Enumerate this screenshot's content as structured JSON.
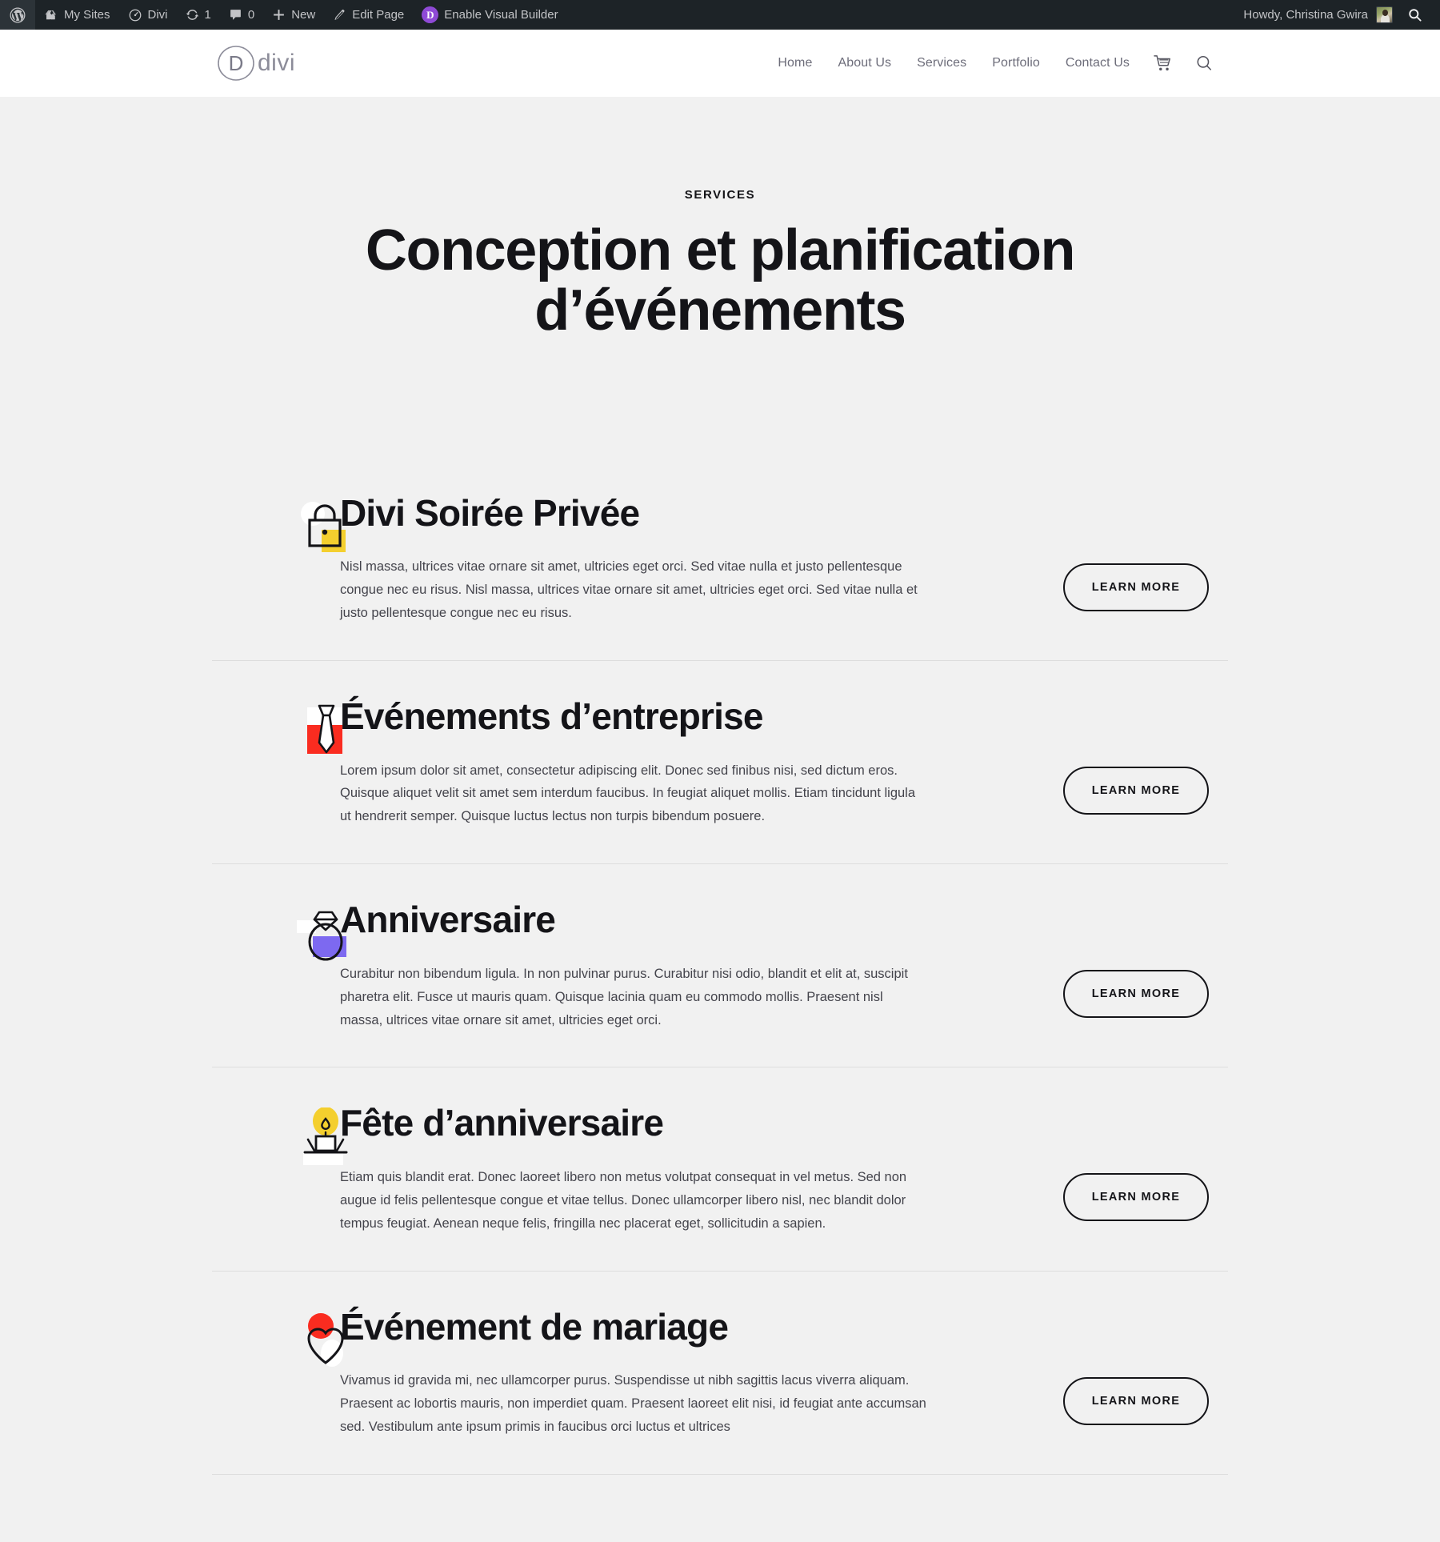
{
  "adminbar": {
    "left_items": [
      {
        "icon": "wordpress-logo-icon",
        "label": ""
      },
      {
        "icon": "my-sites-icon",
        "label": "My Sites"
      },
      {
        "icon": "divi-site-icon",
        "label": "Divi"
      },
      {
        "icon": "updates-icon",
        "label": "1"
      },
      {
        "icon": "comments-icon",
        "label": "0"
      },
      {
        "icon": "plus-icon",
        "label": "New"
      },
      {
        "icon": "pencil-icon",
        "label": "Edit Page"
      },
      {
        "icon": "divi-badge-icon",
        "label": "Enable Visual Builder"
      }
    ],
    "howdy": "Howdy, Christina Gwira",
    "search_icon": "search-icon"
  },
  "header": {
    "logo_letter": "D",
    "logo_word": "divi",
    "nav": [
      {
        "label": "Home"
      },
      {
        "label": "About Us"
      },
      {
        "label": "Services"
      },
      {
        "label": "Portfolio"
      },
      {
        "label": "Contact Us"
      }
    ],
    "cart_icon": "shopping-cart-icon",
    "search_icon": "search-icon"
  },
  "hero": {
    "eyebrow": "SERVICES",
    "title": "Conception et planification d’événements"
  },
  "colors": {
    "page_bg": "#f1f1f1",
    "text": "#141418",
    "accent_yellow": "#f4cf2e",
    "accent_red": "#fa2c20",
    "accent_purple": "#7d69f0",
    "adminbar_bg": "#1d2327",
    "divi_purple": "#8f4ad6"
  },
  "services": [
    {
      "icon": "lock-icon",
      "title": "Divi Soirée Privée",
      "text": "Nisl massa, ultrices vitae ornare sit amet, ultricies eget orci. Sed vitae nulla et justo pellentesque congue nec eu risus. Nisl massa, ultrices vitae ornare sit amet, ultricies eget orci. Sed vitae nulla et justo pellentesque congue nec eu risus.",
      "button": "LEARN MORE"
    },
    {
      "icon": "necktie-icon",
      "title": "Événements d’entreprise",
      "text": "Lorem ipsum dolor sit amet, consectetur adipiscing elit. Donec sed finibus nisi, sed dictum eros. Quisque aliquet velit sit amet sem interdum faucibus. In feugiat aliquet mollis. Etiam tincidunt ligula ut hendrerit semper. Quisque luctus lectus non turpis bibendum posuere.",
      "button": "LEARN MORE"
    },
    {
      "icon": "diamond-ring-icon",
      "title": "Anniversaire",
      "text": "Curabitur non bibendum ligula. In non pulvinar purus. Curabitur nisi odio, blandit et elit at, suscipit pharetra elit. Fusce ut mauris quam. Quisque lacinia quam eu commodo mollis. Praesent nisl massa, ultrices vitae ornare sit amet, ultricies eget orci.",
      "button": "LEARN MORE"
    },
    {
      "icon": "birthday-candle-icon",
      "title": "Fête d’anniversaire",
      "text": "Etiam quis blandit erat. Donec laoreet libero non metus volutpat consequat in vel metus. Sed non augue id felis pellentesque congue et vitae tellus. Donec ullamcorper libero nisl, nec blandit dolor tempus feugiat. Aenean neque felis, fringilla nec placerat eget, sollicitudin a sapien.",
      "button": "LEARN MORE"
    },
    {
      "icon": "heart-icon",
      "title": "Événement de mariage",
      "text": "Vivamus id gravida mi, nec ullamcorper purus. Suspendisse ut nibh sagittis lacus viverra aliquam. Praesent ac lobortis mauris, non imperdiet quam. Praesent laoreet elit nisi, id feugiat ante accumsan sed. Vestibulum ante ipsum primis in faucibus orci luctus et ultrices",
      "button": "LEARN MORE"
    }
  ]
}
